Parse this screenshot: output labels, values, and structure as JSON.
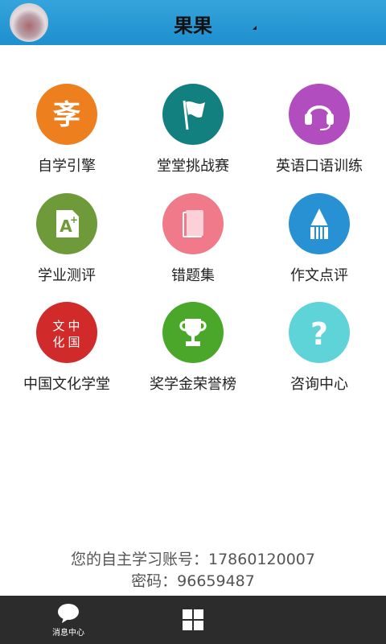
{
  "header": {
    "title": "果果",
    "avatar_icon": "user-avatar"
  },
  "features": [
    {
      "label": "自学引擎",
      "icon": "self-study-icon",
      "color": "#ee7f1e"
    },
    {
      "label": "堂堂挑战赛",
      "icon": "flag-icon",
      "color": "#12807f"
    },
    {
      "label": "英语口语训练",
      "icon": "headset-icon",
      "color": "#b24dbf"
    },
    {
      "label": "学业测评",
      "icon": "grade-document-icon",
      "color": "#6e9a3a"
    },
    {
      "label": "错题集",
      "icon": "book-icon",
      "color": "#f07a8a"
    },
    {
      "label": "作文点评",
      "icon": "pencil-icon",
      "color": "#2791d3"
    },
    {
      "label": "中国文化学堂",
      "icon": "chinese-culture-seal-icon",
      "color": "#d12a2a"
    },
    {
      "label": "奖学金荣誉榜",
      "icon": "trophy-icon",
      "color": "#4aa72a"
    },
    {
      "label": "咨询中心",
      "icon": "question-icon",
      "color": "#5fd4d8"
    }
  ],
  "account": {
    "line1": "您的自主学习账号：17860120007",
    "line2": "密码：96659487"
  },
  "tabbar": {
    "messages_label": "消息中心",
    "messages_icon": "chat-bubble-icon",
    "apps_icon": "grid-icon"
  }
}
